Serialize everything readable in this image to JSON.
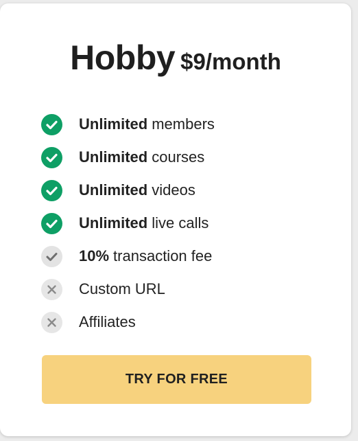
{
  "plan": {
    "name": "Hobby",
    "price": "$9/month"
  },
  "features": [
    {
      "status": "included",
      "icon": "check-circle-icon",
      "bold": "Unlimited",
      "text": "members"
    },
    {
      "status": "included",
      "icon": "check-circle-icon",
      "bold": "Unlimited",
      "text": "courses"
    },
    {
      "status": "included",
      "icon": "check-circle-icon",
      "bold": "Unlimited",
      "text": "videos"
    },
    {
      "status": "included",
      "icon": "check-circle-icon",
      "bold": "Unlimited",
      "text": "live calls"
    },
    {
      "status": "partial",
      "icon": "gray-check-circle-icon",
      "bold": "10%",
      "text": "transaction fee"
    },
    {
      "status": "excluded",
      "icon": "x-circle-icon",
      "bold": "",
      "text": "Custom URL"
    },
    {
      "status": "excluded",
      "icon": "x-circle-icon",
      "bold": "",
      "text": "Affiliates"
    }
  ],
  "cta": {
    "label": "TRY FOR FREE"
  },
  "colors": {
    "check": "#0e9f65",
    "partial_bg": "#e3e3e3",
    "cross_bg": "#e6e6e6",
    "cta_bg": "#f7d27e",
    "card_bg": "#ffffff"
  }
}
